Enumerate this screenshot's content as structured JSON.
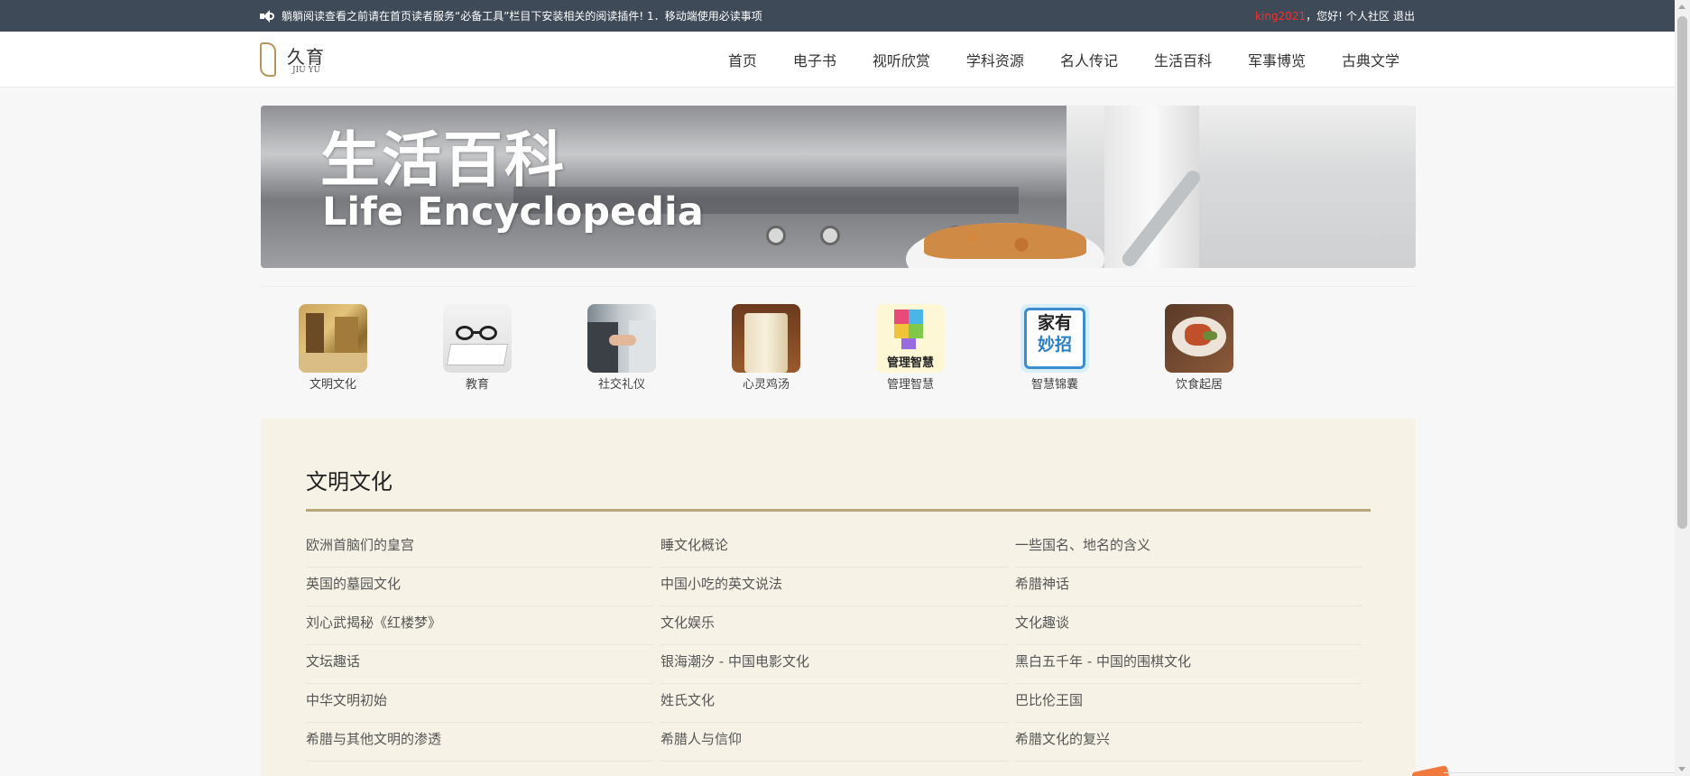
{
  "topbar": {
    "notice": "躺躺阅读查看之前请在首页读者服务“必备工具”栏目下安装相关的阅读插件!  1．移动端使用必读事项",
    "username": "king2021",
    "greeting": "，您好!",
    "community_link": "个人社区",
    "logout_link": "退出"
  },
  "logo": {
    "cn": "久育",
    "en": "JIU YU"
  },
  "nav": [
    "首页",
    "电子书",
    "视听欣赏",
    "学科资源",
    "名人传记",
    "生活百科",
    "军事博览",
    "古典文学"
  ],
  "banner": {
    "title_cn": "生活百科",
    "title_en": "Life Encyclopedia"
  },
  "categories": [
    {
      "label": "文明文化",
      "icon": "palace-painting-icon"
    },
    {
      "label": "教育",
      "icon": "glasses-book-icon"
    },
    {
      "label": "社交礼仪",
      "icon": "handshake-icon"
    },
    {
      "label": "心灵鸡汤",
      "icon": "cup-icon"
    },
    {
      "label": "管理智慧",
      "icon": "cube-book-icon"
    },
    {
      "label": "智慧锦囊",
      "icon": "house-tips-icon"
    },
    {
      "label": "饮食起居",
      "icon": "food-plate-icon"
    }
  ],
  "category_images": {
    "badge_mgmt": "管理智慧",
    "badge_tips_1": "家有",
    "badge_tips_2": "妙招"
  },
  "section": {
    "title": "文明文化",
    "rows": [
      [
        "欧洲首脑们的皇宫",
        "睡文化概论",
        "一些国名、地名的含义"
      ],
      [
        "英国的墓园文化",
        "中国小吃的英文说法",
        "希腊神话"
      ],
      [
        "刘心武揭秘《红楼梦》",
        "文化娱乐",
        "文化趣谈"
      ],
      [
        "文坛趣话",
        "银海潮汐 - 中国电影文化",
        "黑白五千年 - 中国的围棋文化"
      ],
      [
        "中华文明初始",
        "姓氏文化",
        "巴比伦王国"
      ],
      [
        "希腊与其他文明的渗透",
        "希腊人与信仰",
        "希腊文化的复兴"
      ]
    ]
  },
  "colors": {
    "topbar_bg": "#3e4a58",
    "accent_red": "#ff2b2b",
    "panel_bg": "#f6f3e6",
    "rule": "#b8a77a"
  }
}
